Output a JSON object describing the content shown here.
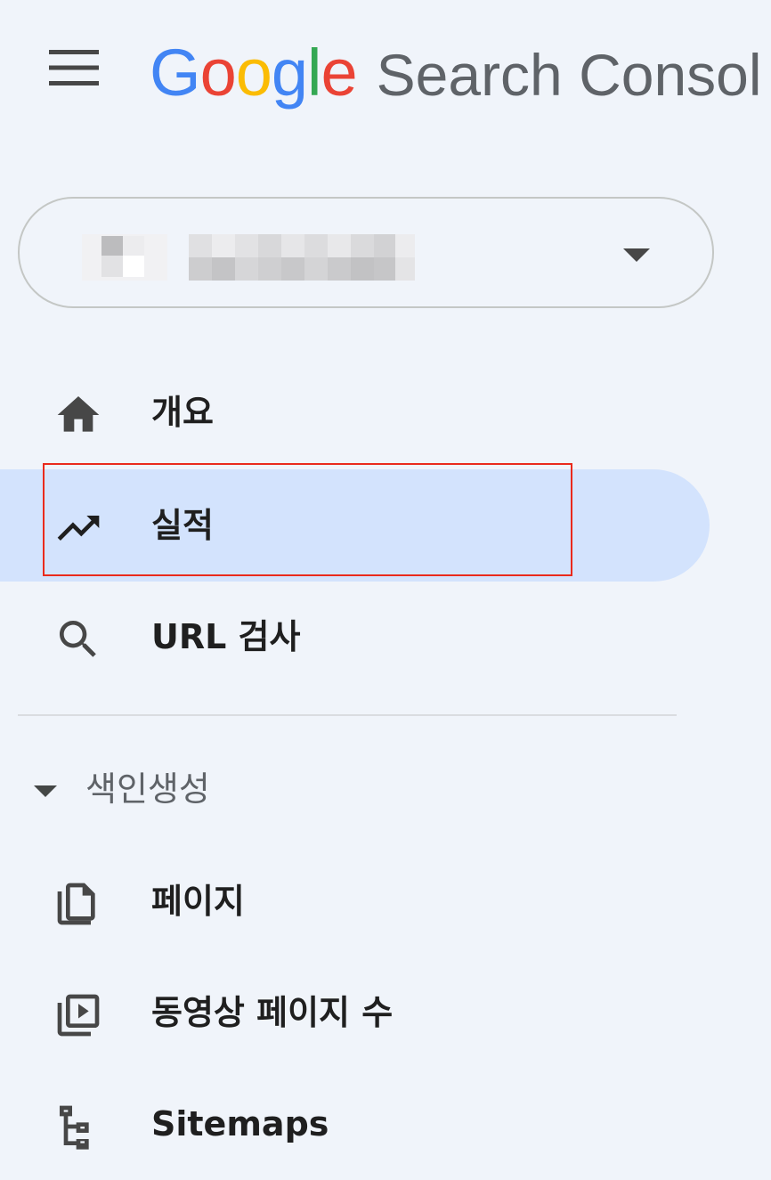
{
  "header": {
    "brand_letters": [
      {
        "char": "G",
        "color": "#4285f4"
      },
      {
        "char": "o",
        "color": "#ea4335"
      },
      {
        "char": "o",
        "color": "#fbbc04"
      },
      {
        "char": "g",
        "color": "#4285f4"
      },
      {
        "char": "l",
        "color": "#34a853"
      },
      {
        "char": "e",
        "color": "#ea4335"
      }
    ],
    "product_name": "Search Consol",
    "menu_icon": "hamburger-menu-icon"
  },
  "property_selector": {
    "name": "",
    "dropdown_icon": "arrow-drop-down-icon"
  },
  "nav": {
    "overview": {
      "label": "개요",
      "icon": "home-icon"
    },
    "performance": {
      "label": "실적",
      "icon": "trending-up-icon",
      "active": true
    },
    "url_inspection": {
      "label": "URL 검사",
      "icon": "search-icon"
    }
  },
  "indexing": {
    "section_label": "색인생성",
    "items": [
      {
        "label": "페이지",
        "icon": "pages-icon"
      },
      {
        "label": "동영상 페이지 수",
        "icon": "video-pages-icon"
      },
      {
        "label": "Sitemaps",
        "icon": "sitemap-icon"
      }
    ]
  },
  "colors": {
    "background": "#f0f4fa",
    "active_nav_background": "#d3e3fd",
    "highlight_border": "#ea2a1c",
    "text_primary": "#1f1f1f",
    "text_secondary": "#5f6368"
  }
}
